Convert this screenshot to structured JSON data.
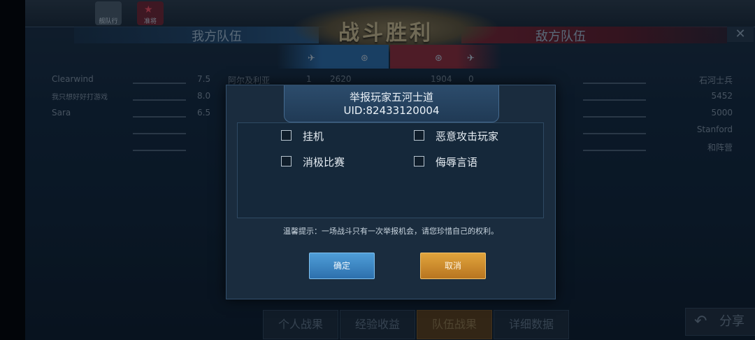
{
  "header": {
    "victory_title": "战斗胜利",
    "left_team": "我方队伍",
    "right_team": "敌方队伍",
    "close_icon": "close-icon",
    "avatars": [
      {
        "label": "舰队行"
      },
      {
        "label": "准将"
      }
    ]
  },
  "table": {
    "col_icons": [
      "plane-icon",
      "wings-icon",
      "wings-icon",
      "plane-icon"
    ],
    "rows": [
      {
        "name": "Clearwind",
        "score": "7.5",
        "ship": "阿尔及利亚",
        "n1": "1",
        "n2": "2620",
        "n3": "1904",
        "n4": "0",
        "rname": "石河士兵"
      },
      {
        "name": "我只想好好打游戏",
        "score": "8.0",
        "ship": "",
        "n1": "",
        "n2": "",
        "n3": "",
        "n4": "",
        "rname": "5452"
      },
      {
        "name": "Sara",
        "score": "6.5",
        "ship": "",
        "n1": "",
        "n2": "",
        "n3": "",
        "n4": "",
        "rname": "5000"
      },
      {
        "name": "",
        "score": "",
        "ship": "",
        "n1": "",
        "n2": "",
        "n3": "",
        "n4": "",
        "rname": "Stanford"
      },
      {
        "name": "",
        "score": "",
        "ship": "",
        "n1": "",
        "n2": "",
        "n3": "",
        "n4": "",
        "rname": "和阵营"
      }
    ]
  },
  "dialog": {
    "title": "举报玩家五河士道",
    "uid": "UID:82433120004",
    "options": [
      {
        "label": "挂机"
      },
      {
        "label": "恶意攻击玩家"
      },
      {
        "label": "消极比赛"
      },
      {
        "label": "侮辱言语"
      }
    ],
    "tip": "温馨提示：一场战斗只有一次举报机会，请您珍惜自己的权利。",
    "confirm_label": "确定",
    "cancel_label": "取消"
  },
  "tabs": [
    {
      "label": "个人战果"
    },
    {
      "label": "经验收益"
    },
    {
      "label": "队伍战果"
    },
    {
      "label": "详细数据"
    }
  ],
  "share": {
    "label": "分享",
    "icon": "share-arrow-icon"
  }
}
